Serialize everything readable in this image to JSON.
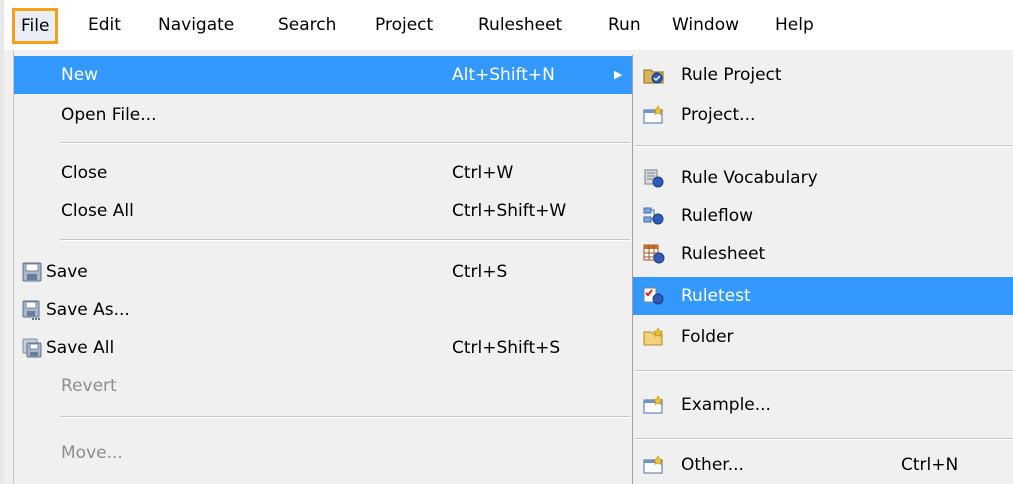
{
  "menubar": {
    "items": [
      "File",
      "Edit",
      "Navigate",
      "Search",
      "Project",
      "Rulesheet",
      "Run",
      "Window",
      "Help"
    ]
  },
  "file_menu": {
    "new": {
      "label": "New",
      "accel": "Alt+Shift+N"
    },
    "open_file": {
      "label": "Open File..."
    },
    "close": {
      "label": "Close",
      "accel": "Ctrl+W"
    },
    "close_all": {
      "label": "Close All",
      "accel": "Ctrl+Shift+W"
    },
    "save": {
      "label": "Save",
      "accel": "Ctrl+S"
    },
    "save_as": {
      "label": "Save As..."
    },
    "save_all": {
      "label": "Save All",
      "accel": "Ctrl+Shift+S"
    },
    "revert": {
      "label": "Revert"
    },
    "move": {
      "label": "Move..."
    }
  },
  "new_submenu": {
    "rule_project": "Rule Project",
    "project": "Project...",
    "rule_vocabulary": "Rule Vocabulary",
    "ruleflow": "Ruleflow",
    "rulesheet": "Rulesheet",
    "ruletest": "Ruletest",
    "folder": "Folder",
    "example": "Example...",
    "other": {
      "label": "Other...",
      "accel": "Ctrl+N"
    }
  },
  "colors": {
    "highlight": "#3399ff",
    "focus_border": "#f6a01a",
    "disabled_text": "#8d8d8d"
  }
}
